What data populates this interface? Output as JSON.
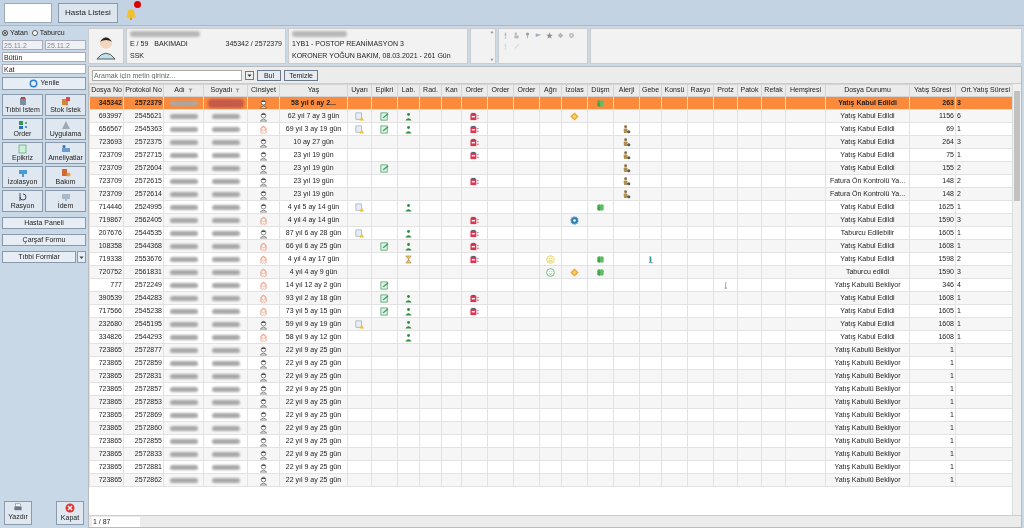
{
  "top_bar": {
    "button": "Hasta Listesi",
    "notification": true
  },
  "sidebar": {
    "radios": [
      {
        "label": "Yatan",
        "selected": true
      },
      {
        "label": "Taburcu",
        "selected": false
      }
    ],
    "dates": [
      "25.11.2",
      "25.11.2"
    ],
    "dropdowns": [
      "Bütün",
      "Kat"
    ],
    "refresh": "Yenile",
    "tools": [
      {
        "label": "Tıbbi İstem",
        "kind": "medical"
      },
      {
        "label": "Stok İstek",
        "kind": "stock"
      },
      {
        "label": "Order",
        "kind": "order"
      },
      {
        "label": "Uygulama",
        "kind": "apply"
      },
      {
        "label": "Epikriz",
        "kind": "epicrisis"
      },
      {
        "label": "Ameliyatlar",
        "kind": "surgery"
      },
      {
        "label": "İzolasyon",
        "kind": "isolation"
      },
      {
        "label": "Bakım",
        "kind": "care"
      },
      {
        "label": "Rasyon",
        "kind": "ration"
      },
      {
        "label": "İdem",
        "kind": "idem"
      }
    ],
    "buttons": [
      "Hasta Paneli",
      "Çarşaf Formu"
    ],
    "forms_button": "Tıbbi Formlar",
    "print": "Yazdır",
    "close": "Kapat"
  },
  "patient": {
    "line_1": "E / 59",
    "status": "BAKIMADI",
    "ids": "345342 / 2572379",
    "insurance": "SSK",
    "ward": "1YB1 - POSTOP REANİMASYON 3",
    "unit": "KORONER YOĞUN BAKIM, 08.03.2021 - 261 Gün"
  },
  "search": {
    "placeholder": "Aramak için metin giriniz...",
    "find": "Bul",
    "clear": "Temizle"
  },
  "table": {
    "columns": [
      {
        "label": "Dosya No",
        "filter": false
      },
      {
        "label": "Protokol No",
        "filter": false
      },
      {
        "label": "Adı",
        "filter": true
      },
      {
        "label": "Soyadı",
        "filter": true
      },
      {
        "label": "Cinsiyet",
        "filter": false
      },
      {
        "label": "Yaş",
        "filter": false
      },
      {
        "label": "Uyarı",
        "filter": false
      },
      {
        "label": "Epikri",
        "filter": false
      },
      {
        "label": "Lab.",
        "filter": false
      },
      {
        "label": "Rad.",
        "filter": false
      },
      {
        "label": "Kan",
        "filter": false
      },
      {
        "label": "Order",
        "filter": false
      },
      {
        "label": "Order",
        "filter": false
      },
      {
        "label": "Order",
        "filter": false
      },
      {
        "label": "Ağrı",
        "filter": false
      },
      {
        "label": "İzolas",
        "filter": false
      },
      {
        "label": "Düşm",
        "filter": false
      },
      {
        "label": "Alerji",
        "filter": false
      },
      {
        "label": "Gebe",
        "filter": false
      },
      {
        "label": "Konsü",
        "filter": false
      },
      {
        "label": "Rasyo",
        "filter": false
      },
      {
        "label": "Protz",
        "filter": false
      },
      {
        "label": "Patok",
        "filter": false
      },
      {
        "label": "Refak",
        "filter": false
      },
      {
        "label": "Hemşiresi",
        "filter": false
      },
      {
        "label": "Dosya Durumu",
        "filter": false
      },
      {
        "label": "Yatış Süresi",
        "filter": false
      },
      {
        "label": "Ort.Yatış Süresi",
        "filter": false
      }
    ],
    "rows": [
      {
        "selected": true,
        "dosya_no": "345342",
        "protokol_no": "2572379",
        "female": false,
        "age": "58 yıl 6 ay 2...",
        "icons": {
          "dusme": {
            "kind": "clover"
          }
        },
        "status": "Yatış Kabul Edildi",
        "stay": "263",
        "avg_stay": "3"
      },
      {
        "selected": false,
        "dosya_no": "693997",
        "protokol_no": "2545621",
        "female": false,
        "age": "62 yıl 7 ay 3 gün",
        "icons": {
          "uyari": {
            "kind": "note"
          },
          "epikriz": {
            "kind": "epicrisis"
          },
          "lab": {
            "kind": "lab"
          },
          "order_1": {
            "kind": "order"
          },
          "izolasyon": {
            "kind": "isolation"
          }
        },
        "status": "Yatış Kabul Edildi",
        "stay": "1156",
        "avg_stay": "6"
      },
      {
        "selected": false,
        "dosya_no": "656567",
        "protokol_no": "2545363",
        "female": true,
        "age": "69 yıl 3 ay 19 gün",
        "icons": {
          "uyari": {
            "kind": "note"
          },
          "epikriz": {
            "kind": "epicrisis"
          },
          "lab": {
            "kind": "lab"
          },
          "order_1": {
            "kind": "order"
          },
          "alerji": {
            "kind": "allergy"
          }
        },
        "status": "Yatış Kabul Edildi",
        "stay": "69",
        "avg_stay": "1"
      },
      {
        "selected": false,
        "dosya_no": "723693",
        "protokol_no": "2572375",
        "female": false,
        "age": "10 ay 27 gün",
        "icons": {
          "order_1": {
            "kind": "order"
          },
          "alerji": {
            "kind": "allergy"
          }
        },
        "status": "Yatış Kabul Edildi",
        "stay": "264",
        "avg_stay": "3"
      },
      {
        "selected": false,
        "dosya_no": "723709",
        "protokol_no": "2572715",
        "female": false,
        "age": "23 yıl 19 gün",
        "icons": {
          "order_1": {
            "kind": "order"
          },
          "alerji": {
            "kind": "allergy"
          }
        },
        "status": "Yatış Kabul Edildi",
        "stay": "75",
        "avg_stay": "1"
      },
      {
        "selected": false,
        "dosya_no": "723709",
        "protokol_no": "2572604",
        "female": false,
        "age": "23 yıl 19 gün",
        "icons": {
          "epikriz": {
            "kind": "epicrisis"
          },
          "alerji": {
            "kind": "allergy"
          }
        },
        "status": "Yatış Kabul Edildi",
        "stay": "155",
        "avg_stay": "2"
      },
      {
        "selected": false,
        "dosya_no": "723709",
        "protokol_no": "2572615",
        "female": false,
        "age": "23 yıl 19 gün",
        "icons": {
          "order_1": {
            "kind": "order"
          },
          "alerji": {
            "kind": "allergy"
          }
        },
        "status": "Fatura Ön Kontrolü Ya...",
        "stay": "148",
        "avg_stay": "2"
      },
      {
        "selected": false,
        "dosya_no": "723709",
        "protokol_no": "2572614",
        "female": false,
        "age": "23 yıl 19 gün",
        "icons": {
          "alerji": {
            "kind": "allergy"
          }
        },
        "status": "Fatura Ön Kontrolü Ya...",
        "stay": "148",
        "avg_stay": "2"
      },
      {
        "selected": false,
        "dosya_no": "714446",
        "protokol_no": "2524995",
        "female": false,
        "age": "4 yıl 5 ay 14 gün",
        "icons": {
          "uyari": {
            "kind": "note"
          },
          "lab": {
            "kind": "lab"
          },
          "dusme": {
            "kind": "clover"
          }
        },
        "status": "Yatış Kabul Edildi",
        "stay": "1625",
        "avg_stay": "1"
      },
      {
        "selected": false,
        "dosya_no": "719867",
        "protokol_no": "2562405",
        "female": true,
        "age": "4 yıl 4 ay 14 gün",
        "icons": {
          "order_1": {
            "kind": "order"
          },
          "izolasyon": {
            "kind": "gear"
          }
        },
        "status": "Yatış Kabul Edildi",
        "stay": "1590",
        "avg_stay": "3"
      },
      {
        "selected": false,
        "dosya_no": "207676",
        "protokol_no": "2544535",
        "female": false,
        "age": "87 yıl 6 ay 28 gün",
        "icons": {
          "uyari": {
            "kind": "note"
          },
          "lab": {
            "kind": "lab"
          },
          "order_1": {
            "kind": "order"
          }
        },
        "status": "Taburcu Edilebilir",
        "stay": "1605",
        "avg_stay": "1"
      },
      {
        "selected": false,
        "dosya_no": "108358",
        "protokol_no": "2544368",
        "female": true,
        "age": "66 yıl 6 ay 25 gün",
        "icons": {
          "epikriz": {
            "kind": "epicrisis"
          },
          "lab": {
            "kind": "lab"
          },
          "order_1": {
            "kind": "order"
          }
        },
        "status": "Yatış Kabul Edildi",
        "stay": "1608",
        "avg_stay": "1"
      },
      {
        "selected": false,
        "dosya_no": "719338",
        "protokol_no": "2553676",
        "female": true,
        "age": "4 yıl 4 ay 17 gün",
        "icons": {
          "lab": {
            "kind": "hourglass"
          },
          "order_1": {
            "kind": "order"
          },
          "agri": {
            "kind": "smiley"
          },
          "dusme": {
            "kind": "clover"
          },
          "gebe": {
            "kind": "foot"
          }
        },
        "status": "Yatış Kabul Edildi",
        "stay": "1598",
        "avg_stay": "2"
      },
      {
        "selected": false,
        "dosya_no": "720752",
        "protokol_no": "2561831",
        "female": true,
        "age": "4 yıl 4 ay 9 gün",
        "icons": {
          "agri": {
            "kind": "smiley_ok"
          },
          "izolasyon": {
            "kind": "isolation"
          },
          "dusme": {
            "kind": "clover"
          }
        },
        "status": "Taburcu edildi",
        "stay": "1590",
        "avg_stay": "3"
      },
      {
        "selected": false,
        "dosya_no": "777",
        "protokol_no": "2572249",
        "female": true,
        "age": "14 yıl 12 ay 2 gün",
        "icons": {
          "epikriz": {
            "kind": "epicrisis"
          },
          "protez": {
            "kind": "prosthesis"
          }
        },
        "status": "Yatış Kabulü Bekliyor",
        "stay": "346",
        "avg_stay": "4"
      },
      {
        "selected": false,
        "dosya_no": "390539",
        "protokol_no": "2544283",
        "female": true,
        "age": "93 yıl 2 ay 18 gün",
        "icons": {
          "epikriz": {
            "kind": "epicrisis"
          },
          "lab": {
            "kind": "lab"
          },
          "order_1": {
            "kind": "order"
          }
        },
        "status": "Yatış Kabul Edildi",
        "stay": "1608",
        "avg_stay": "1"
      },
      {
        "selected": false,
        "dosya_no": "717566",
        "protokol_no": "2545238",
        "female": true,
        "age": "73 yıl 5 ay 15 gün",
        "icons": {
          "epikriz": {
            "kind": "epicrisis"
          },
          "lab": {
            "kind": "lab"
          },
          "order_1": {
            "kind": "order"
          }
        },
        "status": "Yatış Kabul Edildi",
        "stay": "1605",
        "avg_stay": "1"
      },
      {
        "selected": false,
        "dosya_no": "232680",
        "protokol_no": "2545195",
        "female": false,
        "age": "59 yıl 9 ay 19 gün",
        "icons": {
          "uyari": {
            "kind": "note"
          },
          "lab": {
            "kind": "lab"
          }
        },
        "status": "Yatış Kabul Edildi",
        "stay": "1608",
        "avg_stay": "1"
      },
      {
        "selected": false,
        "dosya_no": "334826",
        "protokol_no": "2544293",
        "female": true,
        "age": "58 yıl 9 ay 12 gün",
        "icons": {
          "lab": {
            "kind": "lab"
          }
        },
        "status": "Yatış Kabul Edildi",
        "stay": "1608",
        "avg_stay": "1"
      },
      {
        "selected": false,
        "dosya_no": "723865",
        "protokol_no": "2572877",
        "female": false,
        "age": "22 yıl 9 ay 25 gün",
        "status": "Yatış Kabulü Bekliyor",
        "stay": "1"
      },
      {
        "selected": false,
        "dosya_no": "723865",
        "protokol_no": "2572859",
        "female": false,
        "age": "22 yıl 9 ay 25 gün",
        "status": "Yatış Kabulü Bekliyor",
        "stay": "1"
      },
      {
        "selected": false,
        "dosya_no": "723865",
        "protokol_no": "2572831",
        "female": false,
        "age": "22 yıl 9 ay 25 gün",
        "status": "Yatış Kabulü Bekliyor",
        "stay": "1"
      },
      {
        "selected": false,
        "dosya_no": "723865",
        "protokol_no": "2572857",
        "female": false,
        "age": "22 yıl 9 ay 25 gün",
        "status": "Yatış Kabulü Bekliyor",
        "stay": "1"
      },
      {
        "selected": false,
        "dosya_no": "723865",
        "protokol_no": "2572853",
        "female": false,
        "age": "22 yıl 9 ay 25 gün",
        "status": "Yatış Kabulü Bekliyor",
        "stay": "1"
      },
      {
        "selected": false,
        "dosya_no": "723865",
        "protokol_no": "2572869",
        "female": false,
        "age": "22 yıl 9 ay 25 gün",
        "status": "Yatış Kabulü Bekliyor",
        "stay": "1"
      },
      {
        "selected": false,
        "dosya_no": "723865",
        "protokol_no": "2572860",
        "female": false,
        "age": "22 yıl 9 ay 25 gün",
        "status": "Yatış Kabulü Bekliyor",
        "stay": "1"
      },
      {
        "selected": false,
        "dosya_no": "723865",
        "protokol_no": "2572855",
        "female": false,
        "age": "22 yıl 9 ay 25 gün",
        "status": "Yatış Kabulü Bekliyor",
        "stay": "1"
      },
      {
        "selected": false,
        "dosya_no": "723865",
        "protokol_no": "2572833",
        "female": false,
        "age": "22 yıl 9 ay 25 gün",
        "status": "Yatış Kabulü Bekliyor",
        "stay": "1"
      },
      {
        "selected": false,
        "dosya_no": "723865",
        "protokol_no": "2572881",
        "female": false,
        "age": "22 yıl 9 ay 25 gün",
        "status": "Yatış Kabulü Bekliyor",
        "stay": "1"
      },
      {
        "selected": false,
        "dosya_no": "723865",
        "protokol_no": "2572862",
        "female": false,
        "age": "22 yıl 9 ay 25 gün",
        "status": "Yatış Kabulü Bekliyor",
        "stay": "1"
      }
    ]
  },
  "status_bar": {
    "page": "1 / 87"
  }
}
